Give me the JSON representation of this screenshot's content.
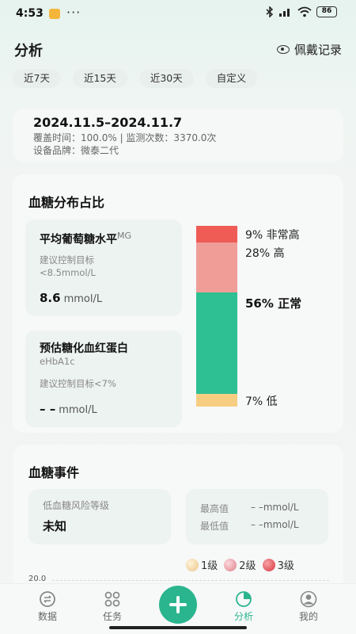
{
  "status_bar": {
    "time": "4:53",
    "dots": "···",
    "battery": "86"
  },
  "header": {
    "title": "分析",
    "wear_record": "佩戴记录"
  },
  "chips": [
    "近7天",
    "近15天",
    "近30天",
    "自定义"
  ],
  "range": {
    "title": "2024.11.5–2024.11.7",
    "coverage": "覆盖时间：100.0% | 监测次数：3370.0次",
    "device": "设备品牌：微泰二代"
  },
  "distribution": {
    "title": "血糖分布占比",
    "avg": {
      "title": "平均葡萄糖水平",
      "sup": "MG",
      "target_label": "建议控制目标",
      "target_value": "<8.5mmol/L",
      "value": "8.6",
      "unit": "mmol/L"
    },
    "hba1c": {
      "title": "预估糖化血红蛋白",
      "subtitle": "eHbA1c",
      "target": "建议控制目标<7%",
      "value": "– –",
      "unit": "mmol/L"
    },
    "segments": [
      {
        "pct": 9,
        "pct_label": "9%",
        "name": "非常高",
        "color": "#ef5b55"
      },
      {
        "pct": 28,
        "pct_label": "28%",
        "name": "高",
        "color": "#f09d98"
      },
      {
        "pct": 56,
        "pct_label": "56%",
        "name": "正常",
        "color": "#2ebf93"
      },
      {
        "pct": 7,
        "pct_label": "7%",
        "name": "低",
        "color": "#f7cd82"
      }
    ]
  },
  "events": {
    "title": "血糖事件",
    "risk_label": "低血糖风险等级",
    "risk_value": "未知",
    "max_label": "最高值",
    "max_value": "– –mmol/L",
    "min_label": "最低值",
    "min_value": "– –mmol/L",
    "legend": [
      {
        "label": "1级",
        "color": "#f2d29e"
      },
      {
        "label": "2级",
        "color": "#e79aa2"
      },
      {
        "label": "3级",
        "color": "#e2555e"
      }
    ],
    "axis_top": "20.0"
  },
  "nav": {
    "data": "数据",
    "tasks": "任务",
    "analysis": "分析",
    "mine": "我的"
  }
}
